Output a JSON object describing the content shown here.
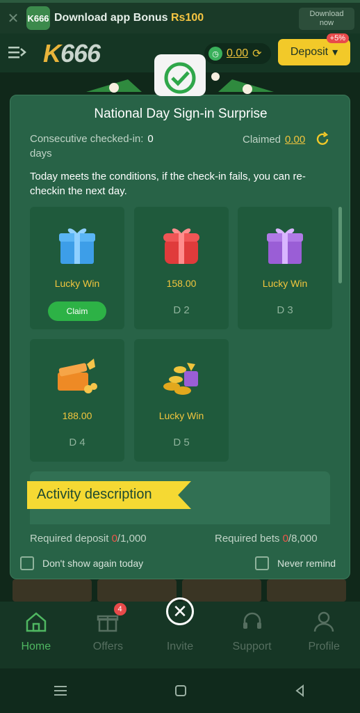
{
  "banner": {
    "logo": "K666",
    "text": "Download app Bonus ",
    "bonus": "Rs100",
    "download_label_1": "Download",
    "download_label_2": "now"
  },
  "header": {
    "logo_k": "K",
    "logo_num": "666",
    "wallet_amount": "0.00",
    "deposit_label": "Deposit",
    "deposit_badge": "+5%"
  },
  "modal": {
    "title": "National Day Sign-in Surprise",
    "consecutive_label": "Consecutive checked-in:",
    "consecutive_count": "0",
    "consecutive_unit": "days",
    "claimed_label": "Claimed",
    "claimed_amount": "0.00",
    "notice": "Today meets the conditions, if the check-in fails, you can re-checkin the next day.",
    "cards": [
      {
        "value": "Lucky Win",
        "day": "",
        "action": "Claim",
        "gift_color": "#3d9ee8",
        "ribbon_color": "#8fd0ff"
      },
      {
        "value": "158.00",
        "day": "D 2",
        "gift_color": "#e03b3b",
        "ribbon_color": "#ff8d8d"
      },
      {
        "value": "Lucky Win",
        "day": "D 3",
        "gift_color": "#9a5ed6",
        "ribbon_color": "#d9b6ff"
      },
      {
        "value": "188.00",
        "day": "D 4",
        "gift_color": "#ee8a25",
        "ribbon_color": "#f6c44a"
      },
      {
        "value": "Lucky Win",
        "day": "D 5",
        "gift_color": "#e2a81d",
        "ribbon_color": "#9a5ed6"
      }
    ],
    "activity_title": "Activity description",
    "req_deposit_label": "Required deposit ",
    "req_deposit_current": "0",
    "req_deposit_total": "/1,000",
    "req_bets_label": "Required bets ",
    "req_bets_current": "0",
    "req_bets_total": "/8,000",
    "dont_show_label": "Don't show again today",
    "never_remind_label": "Never remind"
  },
  "nav": [
    {
      "label": "Home"
    },
    {
      "label": "Offers",
      "badge": "4"
    },
    {
      "label": "Invite"
    },
    {
      "label": "Support"
    },
    {
      "label": "Profile"
    }
  ],
  "colors": {
    "accent": "#f2c929",
    "active": "#4fb761",
    "modal_bg": "#286347",
    "claim": "#2db246"
  }
}
